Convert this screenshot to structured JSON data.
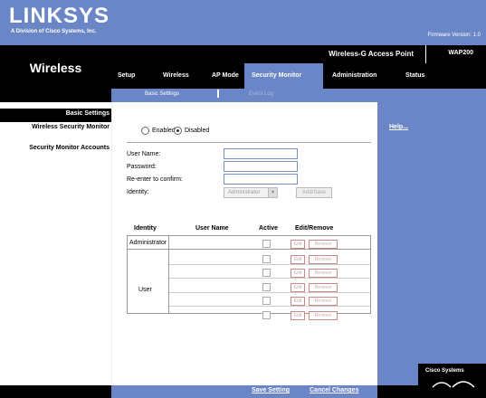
{
  "header": {
    "logo": "LINKSYS",
    "tagline": "A Division of Cisco Systems, Inc.",
    "firmware": "Firmware Version: 1.0"
  },
  "product": {
    "name": "Wireless-G Access Point",
    "model": "WAP200"
  },
  "section": {
    "title": "Wireless"
  },
  "menu": {
    "items": [
      "Setup",
      "Wireless",
      "AP Mode",
      "Security Monitor",
      "Administration",
      "Status"
    ],
    "active": "Security Monitor"
  },
  "submenu": {
    "items": [
      "Basic Settings",
      "Event Log"
    ]
  },
  "left": {
    "heading": "Basic Settings",
    "item1": "Wireless Security Monitor",
    "item2": "Security Monitor Accounts"
  },
  "right": {
    "help": "Help..."
  },
  "monitor": {
    "enabled_label": "Enabled",
    "disabled_label": "Disabled",
    "selected": "Disabled"
  },
  "account_form": {
    "user_name_label": "User Name:",
    "password_label": "Password:",
    "reenter_label": "Re-enter to confirm:",
    "identity_label": "Identity:",
    "identity_value": "Administrator",
    "add_save_label": "Add/Save"
  },
  "accounts_table": {
    "headers": [
      "Identity",
      "User Name",
      "Active",
      "Edit/Remove"
    ],
    "rows": [
      {
        "identity": "Administrator",
        "user_name": ""
      },
      {
        "identity": "",
        "user_name": ""
      },
      {
        "identity": "",
        "user_name": ""
      },
      {
        "identity": "User",
        "user_name": ""
      },
      {
        "identity": "",
        "user_name": ""
      },
      {
        "identity": "",
        "user_name": ""
      }
    ],
    "edit_label": "Edit",
    "remove_label": "Remove"
  },
  "footer": {
    "save_label": "Save Setting",
    "cancel_label": "Cancel Changes",
    "cisco": "Cisco Systems"
  },
  "colors": {
    "brand_blue": "#6b86c6",
    "black": "#000000"
  }
}
